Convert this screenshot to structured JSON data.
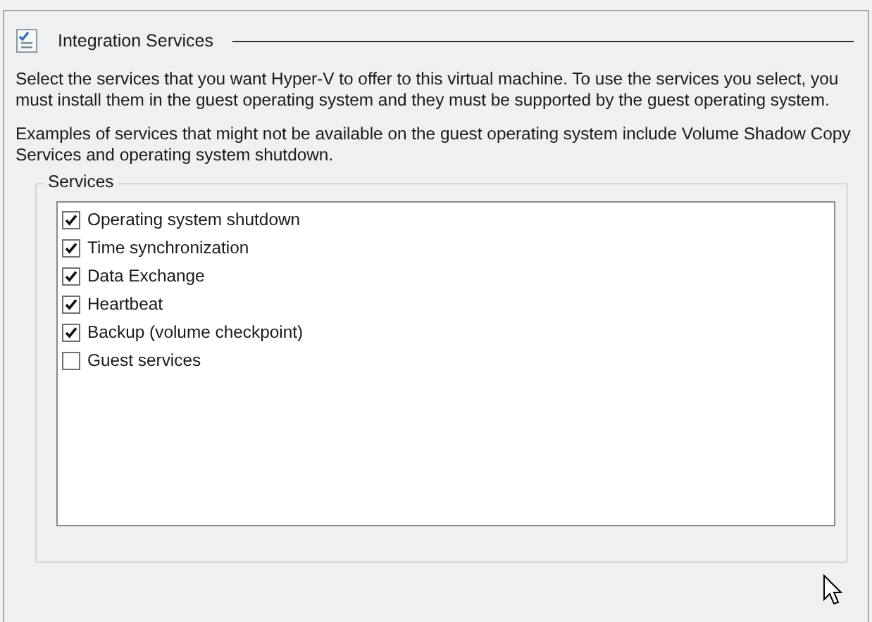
{
  "section": {
    "title": "Integration Services"
  },
  "paragraphs": [
    "Select the services that you want Hyper-V to offer to this virtual machine. To use the services you select, you must install them in the guest operating system and they must be supported by the guest operating system.",
    "Examples of services that might not be available on the guest operating system include Volume Shadow Copy Services and operating system shutdown."
  ],
  "services": {
    "label": "Services",
    "items": [
      {
        "label": "Operating system shutdown",
        "checked": true
      },
      {
        "label": "Time synchronization",
        "checked": true
      },
      {
        "label": "Data Exchange",
        "checked": true
      },
      {
        "label": "Heartbeat",
        "checked": true
      },
      {
        "label": "Backup (volume checkpoint)",
        "checked": true
      },
      {
        "label": "Guest services",
        "checked": false
      }
    ]
  }
}
